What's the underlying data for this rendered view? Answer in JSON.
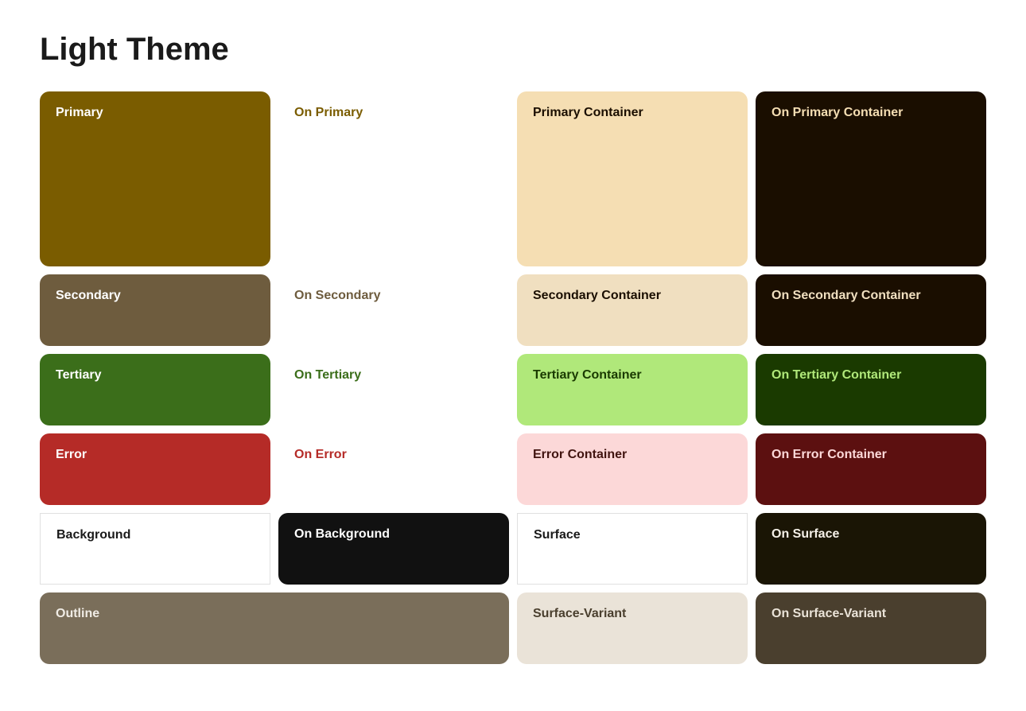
{
  "title": "Light Theme",
  "rows": [
    {
      "cells": [
        {
          "label": "Primary",
          "bg": "#7a5c00",
          "color": "#ffffff",
          "span": 1,
          "tall": true,
          "radius": "12px"
        },
        {
          "label": "On Primary",
          "bg": "#ffffff",
          "color": "#7a5c00",
          "span": 1,
          "tall": true,
          "radius": "0"
        },
        {
          "label": "Primary Container",
          "bg": "#f5deb3",
          "color": "#1a0e00",
          "span": 1,
          "tall": true,
          "radius": "12px"
        },
        {
          "label": "On Primary Container",
          "bg": "#1a0e00",
          "color": "#f5deb3",
          "span": 1,
          "tall": true,
          "radius": "12px"
        }
      ]
    },
    {
      "cells": [
        {
          "label": "Secondary",
          "bg": "#6e5c3e",
          "color": "#ffffff",
          "span": 1,
          "tall": false,
          "radius": "12px"
        },
        {
          "label": "On Secondary",
          "bg": "#ffffff",
          "color": "#6e5c3e",
          "span": 1,
          "tall": false,
          "radius": "0"
        },
        {
          "label": "Secondary Container",
          "bg": "#f0dfc0",
          "color": "#1a0e00",
          "span": 1,
          "tall": false,
          "radius": "12px"
        },
        {
          "label": "On Secondary Container",
          "bg": "#1a0e00",
          "color": "#f0dfc0",
          "span": 1,
          "tall": false,
          "radius": "12px"
        }
      ]
    },
    {
      "cells": [
        {
          "label": "Tertiary",
          "bg": "#3b6e1a",
          "color": "#ffffff",
          "span": 1,
          "tall": false,
          "radius": "12px"
        },
        {
          "label": "On Tertiary",
          "bg": "#ffffff",
          "color": "#3b6e1a",
          "span": 1,
          "tall": false,
          "radius": "0"
        },
        {
          "label": "Tertiary Container",
          "bg": "#b0e87a",
          "color": "#1a3a00",
          "span": 1,
          "tall": false,
          "radius": "12px"
        },
        {
          "label": "On Tertiary Container",
          "bg": "#1a3a00",
          "color": "#b0e87a",
          "span": 1,
          "tall": false,
          "radius": "12px"
        }
      ]
    },
    {
      "cells": [
        {
          "label": "Error",
          "bg": "#b52b27",
          "color": "#ffffff",
          "span": 1,
          "tall": false,
          "radius": "12px"
        },
        {
          "label": "On Error",
          "bg": "#ffffff",
          "color": "#b52b27",
          "span": 1,
          "tall": false,
          "radius": "0"
        },
        {
          "label": "Error Container",
          "bg": "#fcd8d8",
          "color": "#411410",
          "span": 1,
          "tall": false,
          "radius": "12px"
        },
        {
          "label": "On Error Container",
          "bg": "#5c1010",
          "color": "#fcd8d8",
          "span": 1,
          "tall": false,
          "radius": "12px"
        }
      ]
    },
    {
      "cells": [
        {
          "label": "Background",
          "bg": "#ffffff",
          "color": "#1a1a1a",
          "span": 1,
          "tall": false,
          "radius": "0",
          "border": "1px solid #e0e0e0"
        },
        {
          "label": "On Background",
          "bg": "#111111",
          "color": "#ffffff",
          "span": 1,
          "tall": false,
          "radius": "12px"
        },
        {
          "label": "Surface",
          "bg": "#ffffff",
          "color": "#1a1a1a",
          "span": 1,
          "tall": false,
          "radius": "0",
          "border": "1px solid #e0e0e0"
        },
        {
          "label": "On Surface",
          "bg": "#1a1505",
          "color": "#f5f0e8",
          "span": 1,
          "tall": false,
          "radius": "12px"
        }
      ]
    },
    {
      "cells": [
        {
          "label": "Outline",
          "bg": "#7a6e5a",
          "color": "#f0ece5",
          "span": 2,
          "tall": false,
          "radius": "12px"
        },
        {
          "label": "Surface-Variant",
          "bg": "#eae3d8",
          "color": "#4a3f2e",
          "span": 1,
          "tall": false,
          "radius": "12px"
        },
        {
          "label": "On Surface-Variant",
          "bg": "#4a3f2e",
          "color": "#eae3d8",
          "span": 1,
          "tall": false,
          "radius": "12px"
        }
      ]
    }
  ]
}
